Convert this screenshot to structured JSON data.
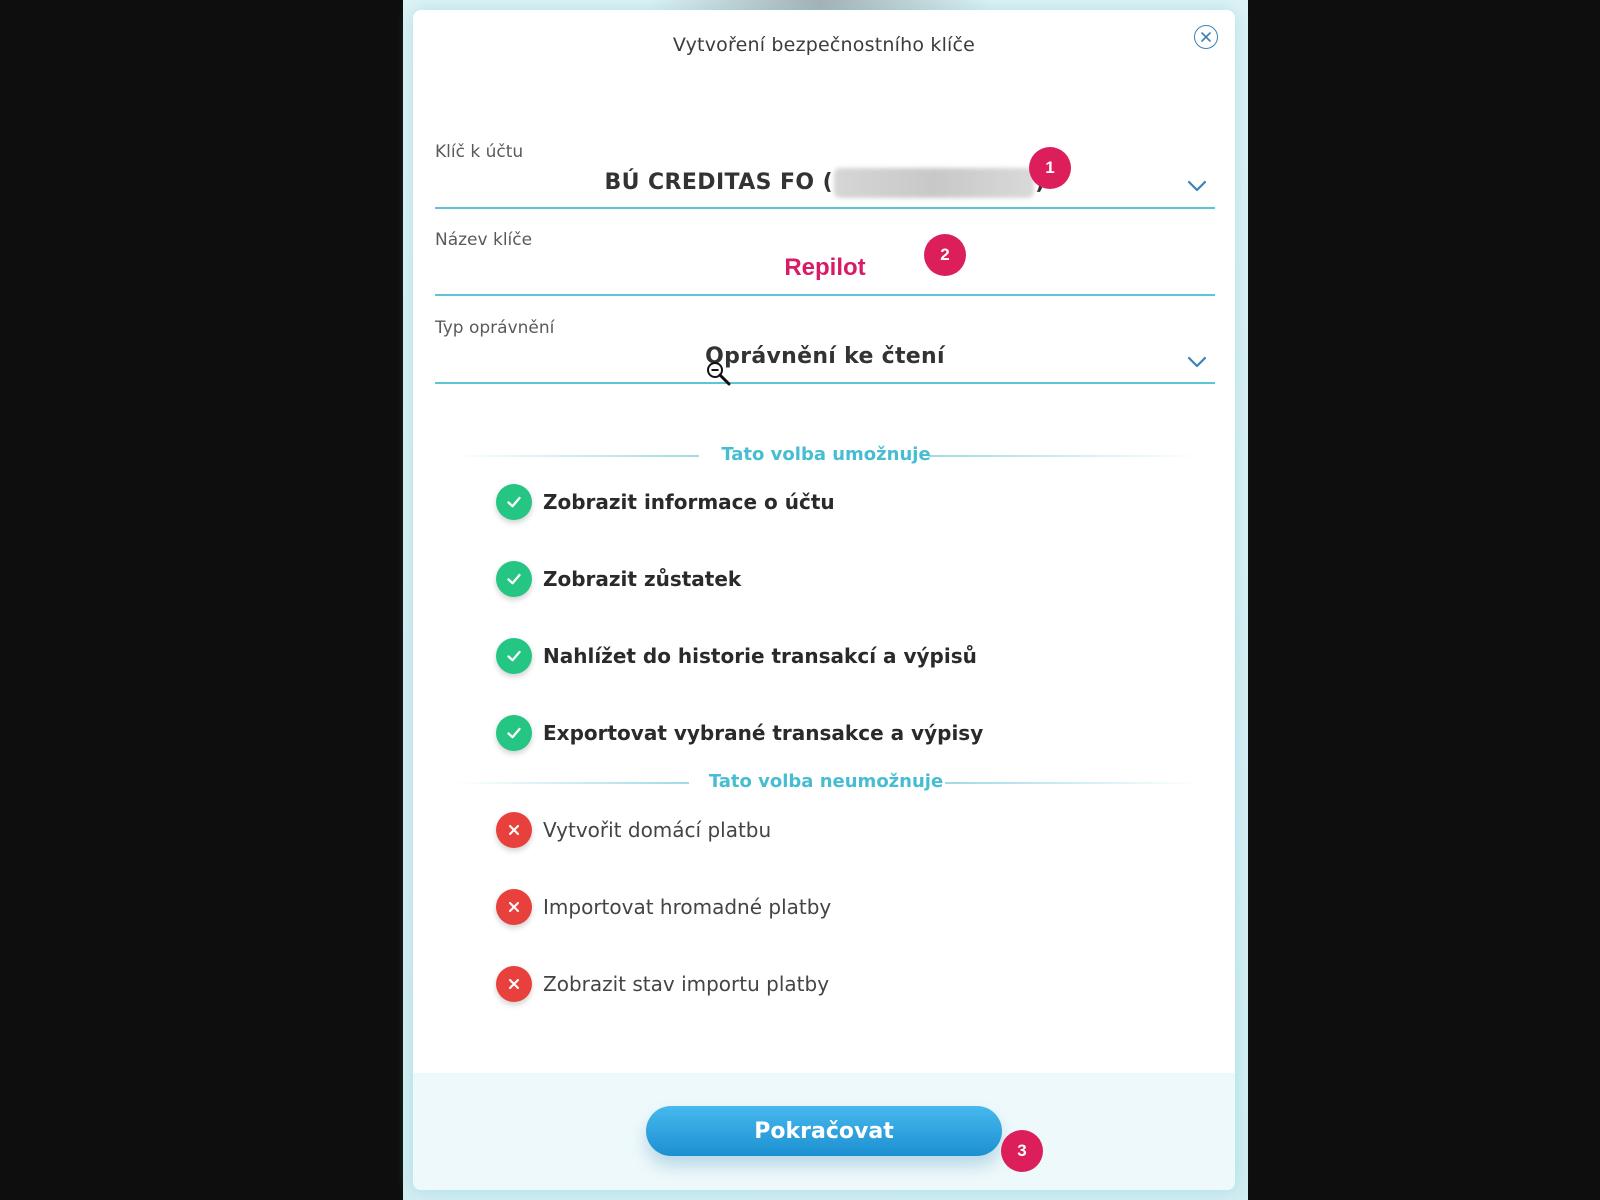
{
  "modal": {
    "title": "Vytvoření bezpečnostního klíče",
    "close_icon": "close-circle-icon"
  },
  "fields": {
    "account": {
      "label": "Klíč k účtu",
      "value_prefix": "BÚ CREDITAS FO (",
      "value_suffix": ")"
    },
    "key_name": {
      "label": "Název klíče",
      "value": "Repilot"
    },
    "permission_type": {
      "label": "Typ oprávnění",
      "value": "Oprávnění ke čtení"
    }
  },
  "allowed": {
    "heading": "Tato volba umožnuje",
    "items": [
      "Zobrazit informace o účtu",
      "Zobrazit zůstatek",
      "Nahlížet do historie transakcí a výpisů",
      "Exportovat vybrané transakce a výpisy"
    ]
  },
  "denied": {
    "heading": "Tato volba neumožnuje",
    "items": [
      "Vytvořit domácí platbu",
      "Importovat hromadné platby",
      "Zobrazit stav importu platby"
    ]
  },
  "footer": {
    "continue_label": "Pokračovat"
  },
  "markers": [
    "1",
    "2",
    "3"
  ],
  "colors": {
    "accent_line": "#5cc6d6",
    "section_heading": "#47bdd1",
    "allowed_icon": "#25c584",
    "denied_icon": "#e8403c",
    "marker": "#dc1e5a",
    "key_name_text": "#d81b66",
    "button": "#1c8fd0"
  }
}
